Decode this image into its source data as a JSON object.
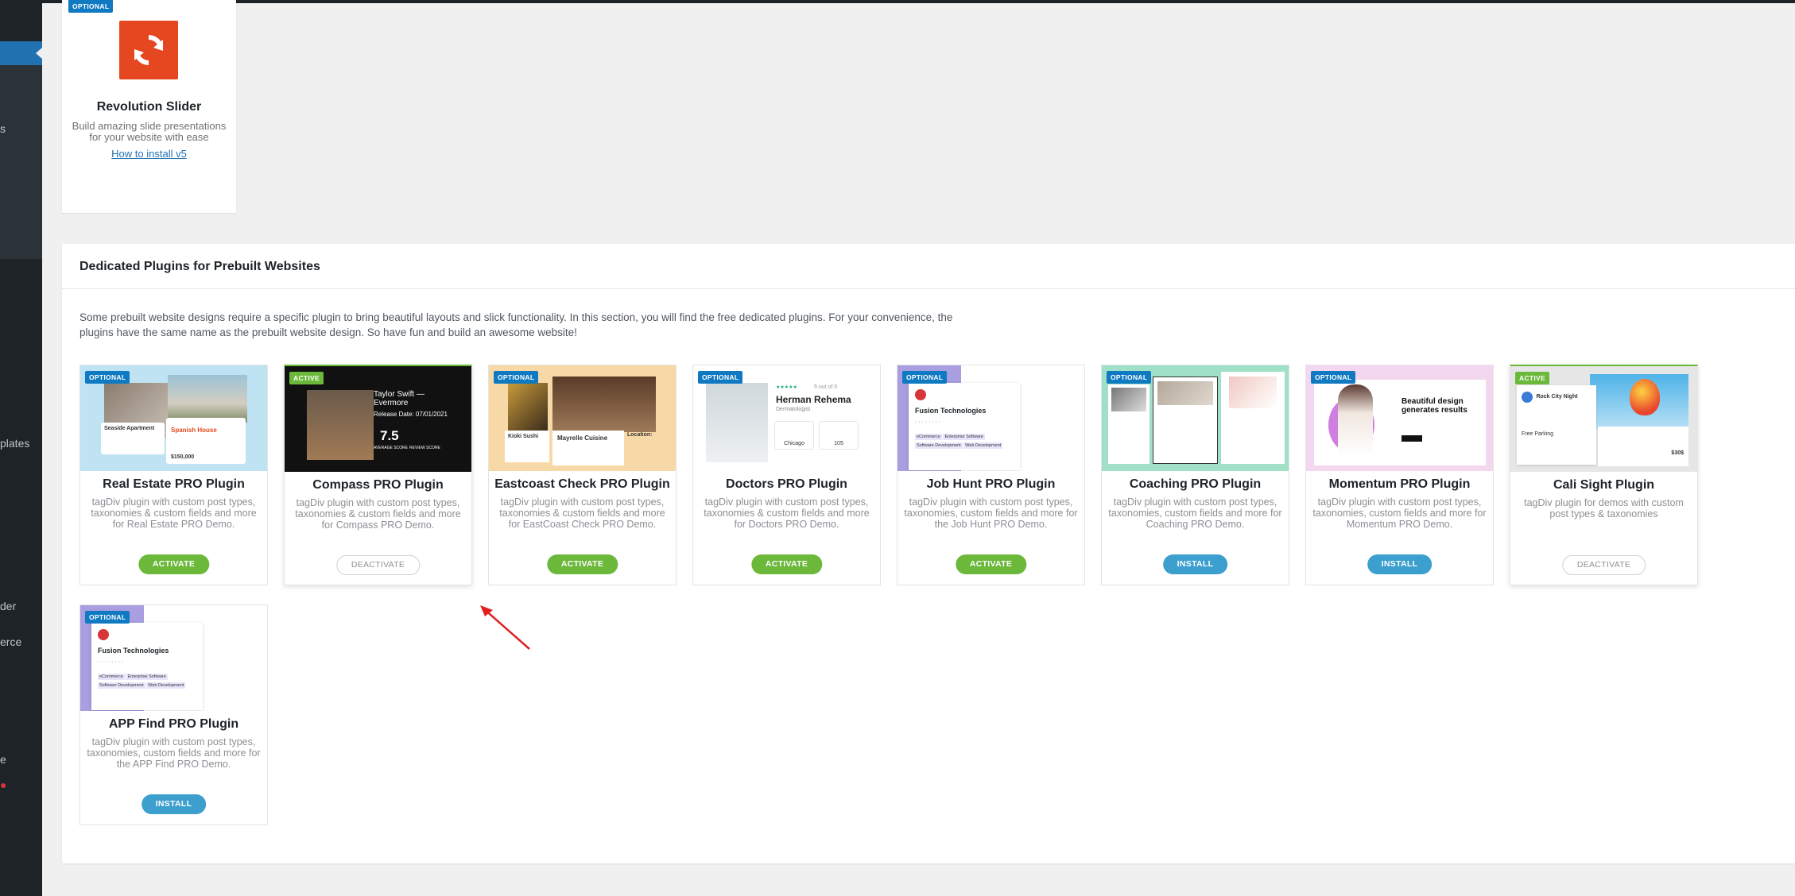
{
  "sidebar": {
    "fragments": [
      "s",
      "plates",
      "der",
      "erce",
      "e"
    ]
  },
  "rev": {
    "badge": "OPTIONAL",
    "title": "Revolution Slider",
    "desc": "Build amazing slide presentations for your website with ease",
    "link": "How to install v5"
  },
  "section": {
    "title": "Dedicated Plugins for Prebuilt Websites",
    "desc": "Some prebuilt website designs require a specific plugin to bring beautiful layouts and slick functionality. In this section, you will find the free dedicated plugins. For your convenience, the plugins have the same name as the prebuilt website design. So have fun and build an awesome website!"
  },
  "plugins": [
    {
      "badge": "OPTIONAL",
      "title": "Real Estate PRO Plugin",
      "desc": "tagDiv plugin with custom post types, taxonomies & custom fields and more for Real Estate PRO Demo.",
      "button": "ACTIVATE",
      "thumb_text": [
        "Seaside Apartment",
        "Spanish House",
        "$150,000"
      ]
    },
    {
      "badge": "ACTIVE",
      "title": "Compass PRO Plugin",
      "desc": "tagDiv plugin with custom post types, taxonomies & custom fields and more for Compass PRO Demo.",
      "button": "DEACTIVATE",
      "thumb_text": [
        "Taylor Swift — Evermore",
        "Release Date: 07/01/2021",
        "7.5",
        "AVERAGE SCORE",
        "REVIEW SCORE"
      ]
    },
    {
      "badge": "OPTIONAL",
      "title": "Eastcoast Check PRO Plugin",
      "desc": "tagDiv plugin with custom post types, taxonomies & custom fields and more for EastCoast Check PRO Demo.",
      "button": "ACTIVATE",
      "thumb_text": [
        "Kioki Sushi",
        "Mayrelle Cuisine",
        "Location:"
      ]
    },
    {
      "badge": "OPTIONAL",
      "title": "Doctors PRO Plugin",
      "desc": "tagDiv plugin with custom post types, taxonomies & custom fields and more for Doctors PRO Demo.",
      "button": "ACTIVATE",
      "thumb_text": [
        "5 out of 5",
        "Herman Rehema",
        "Dermatologist",
        "Chicago",
        "105"
      ]
    },
    {
      "badge": "OPTIONAL",
      "title": "Job Hunt PRO Plugin",
      "desc": "tagDiv plugin with custom post types, taxonomies, custom fields and more for the Job Hunt PRO Demo.",
      "button": "ACTIVATE",
      "thumb_text": [
        "Fusion Technologies",
        "eCommerce",
        "Enterprise Software",
        "Software Development",
        "Web Development"
      ]
    },
    {
      "badge": "OPTIONAL",
      "title": "Coaching PRO Plugin",
      "desc": "tagDiv plugin with custom post types, taxonomies, custom fields and more for Coaching PRO Demo.",
      "button": "INSTALL",
      "thumb_text": []
    },
    {
      "badge": "OPTIONAL",
      "title": "Momentum PRO Plugin",
      "desc": "tagDiv plugin with custom post types, taxonomies, custom fields and more for Momentum PRO Demo.",
      "button": "INSTALL",
      "thumb_text": [
        "Beautiful design generates results"
      ]
    },
    {
      "badge": "ACTIVE",
      "title": "Cali Sight Plugin",
      "desc": "tagDiv plugin for demos with custom post types & taxonomies",
      "button": "DEACTIVATE",
      "thumb_text": [
        "Rock City Night",
        "Free Parking",
        "$30$"
      ]
    },
    {
      "badge": "OPTIONAL",
      "title": "APP Find PRO Plugin",
      "desc": "tagDiv plugin with custom post types, taxonomies, custom fields and more for the APP Find PRO Demo.",
      "button": "INSTALL",
      "thumb_text": [
        "Fusion Technologies",
        "eCommerce",
        "Enterprise Software",
        "Software Development",
        "Web Development"
      ]
    }
  ],
  "colors": {
    "activate": "#6bb83b",
    "install": "#3d9fce",
    "badge_optional": "#0f7ac2",
    "badge_active": "#6bb83b",
    "revolution_logo": "#e54720",
    "annotation_arrow": "#e02020"
  }
}
